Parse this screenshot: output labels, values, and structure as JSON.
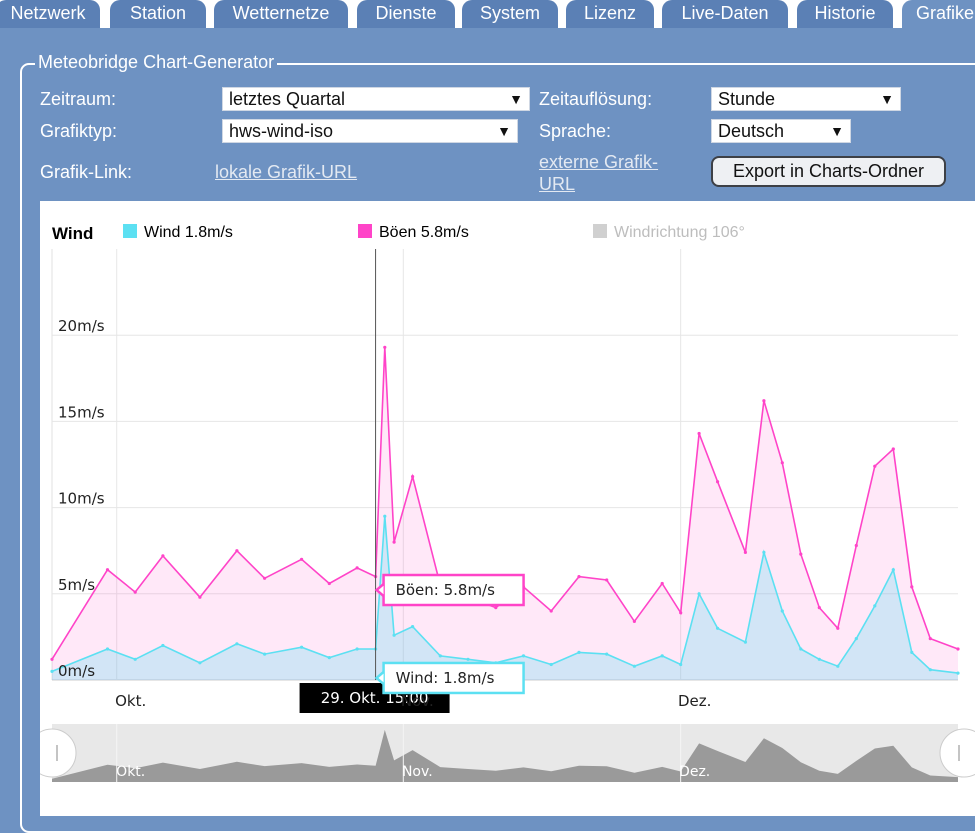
{
  "tabs": [
    "Netzwerk",
    "Station",
    "Wetternetze",
    "Dienste",
    "System",
    "Lizenz",
    "Live-Daten",
    "Historie",
    "Grafike"
  ],
  "panel": {
    "title": "Meteobridge Chart-Generator",
    "zeitraum_label": "Zeitraum:",
    "zeitraum_value": "letztes Quartal",
    "aufloesung_label": "Zeitauflösung:",
    "aufloesung_value": "Stunde",
    "grafiktyp_label": "Grafiktyp:",
    "grafiktyp_value": "hws-wind-iso",
    "sprache_label": "Sprache:",
    "sprache_value": "Deutsch",
    "link_label": "Grafik-Link:",
    "local_link": "lokale Grafik-URL",
    "external_link_line1": "externe Grafik-",
    "external_link_line2": "URL",
    "export_button": "Export in Charts-Ordner",
    "arrow": "▼"
  },
  "chart_data": {
    "type": "area",
    "title": "Wind",
    "legend": [
      {
        "label": "Wind 1.8m/s",
        "color": "#5ce0f2"
      },
      {
        "label": "Böen 5.8m/s",
        "color": "#ff44c8"
      },
      {
        "label": "Windrichtung 106°",
        "color": "#bbbbbb",
        "disabled": true
      }
    ],
    "y_ticks": [
      "0m/s",
      "5m/s",
      "10m/s",
      "15m/s",
      "20m/s"
    ],
    "ylim": [
      0,
      25
    ],
    "x_ticks": [
      "Okt.",
      "Nov.",
      "Dez."
    ],
    "x_range": [
      "2023-09-24",
      "2023-12-31"
    ],
    "crosshair_label": "29. Okt. 15:00",
    "tooltip_boeen": "Böen: 5.8m/s",
    "tooltip_wind": "Wind: 1.8m/s",
    "series": [
      {
        "name": "Böen",
        "color": "#ff44c8",
        "x": [
          "2023-09-24",
          "2023-09-30",
          "2023-10-03",
          "2023-10-06",
          "2023-10-10",
          "2023-10-14",
          "2023-10-17",
          "2023-10-21",
          "2023-10-24",
          "2023-10-27",
          "2023-10-29",
          "2023-10-30",
          "2023-10-31",
          "2023-11-02",
          "2023-11-05",
          "2023-11-08",
          "2023-11-11",
          "2023-11-14",
          "2023-11-17",
          "2023-11-20",
          "2023-11-23",
          "2023-11-26",
          "2023-11-29",
          "2023-12-01",
          "2023-12-03",
          "2023-12-05",
          "2023-12-08",
          "2023-12-10",
          "2023-12-12",
          "2023-12-14",
          "2023-12-16",
          "2023-12-18",
          "2023-12-20",
          "2023-12-22",
          "2023-12-24",
          "2023-12-26",
          "2023-12-28",
          "2023-12-31"
        ],
        "values": [
          1.2,
          6.4,
          5.1,
          7.2,
          4.8,
          7.5,
          5.9,
          7.0,
          5.6,
          6.5,
          6.0,
          19.3,
          8.0,
          11.8,
          5.5,
          4.8,
          4.2,
          5.4,
          4.0,
          6.0,
          5.8,
          3.4,
          5.6,
          3.9,
          14.3,
          11.5,
          7.4,
          16.2,
          12.6,
          7.3,
          4.2,
          3.0,
          7.8,
          12.4,
          13.4,
          5.4,
          2.4,
          1.8
        ]
      },
      {
        "name": "Wind",
        "color": "#5ce0f2",
        "x": [
          "2023-09-24",
          "2023-09-30",
          "2023-10-03",
          "2023-10-06",
          "2023-10-10",
          "2023-10-14",
          "2023-10-17",
          "2023-10-21",
          "2023-10-24",
          "2023-10-27",
          "2023-10-29",
          "2023-10-30",
          "2023-10-31",
          "2023-11-02",
          "2023-11-05",
          "2023-11-08",
          "2023-11-11",
          "2023-11-14",
          "2023-11-17",
          "2023-11-20",
          "2023-11-23",
          "2023-11-26",
          "2023-11-29",
          "2023-12-01",
          "2023-12-03",
          "2023-12-05",
          "2023-12-08",
          "2023-12-10",
          "2023-12-12",
          "2023-12-14",
          "2023-12-16",
          "2023-12-18",
          "2023-12-20",
          "2023-12-22",
          "2023-12-24",
          "2023-12-26",
          "2023-12-28",
          "2023-12-31"
        ],
        "values": [
          0.5,
          1.8,
          1.2,
          2.0,
          1.0,
          2.1,
          1.5,
          1.9,
          1.3,
          1.8,
          1.8,
          9.5,
          2.6,
          3.1,
          1.4,
          1.2,
          1.0,
          1.4,
          0.9,
          1.6,
          1.5,
          0.8,
          1.4,
          0.9,
          5.0,
          3.0,
          2.2,
          7.4,
          4.0,
          1.8,
          1.2,
          0.8,
          2.4,
          4.3,
          6.4,
          1.6,
          0.6,
          0.4
        ]
      }
    ],
    "navigator_ticks": [
      "Okt.",
      "Nov.",
      "Dez."
    ]
  }
}
